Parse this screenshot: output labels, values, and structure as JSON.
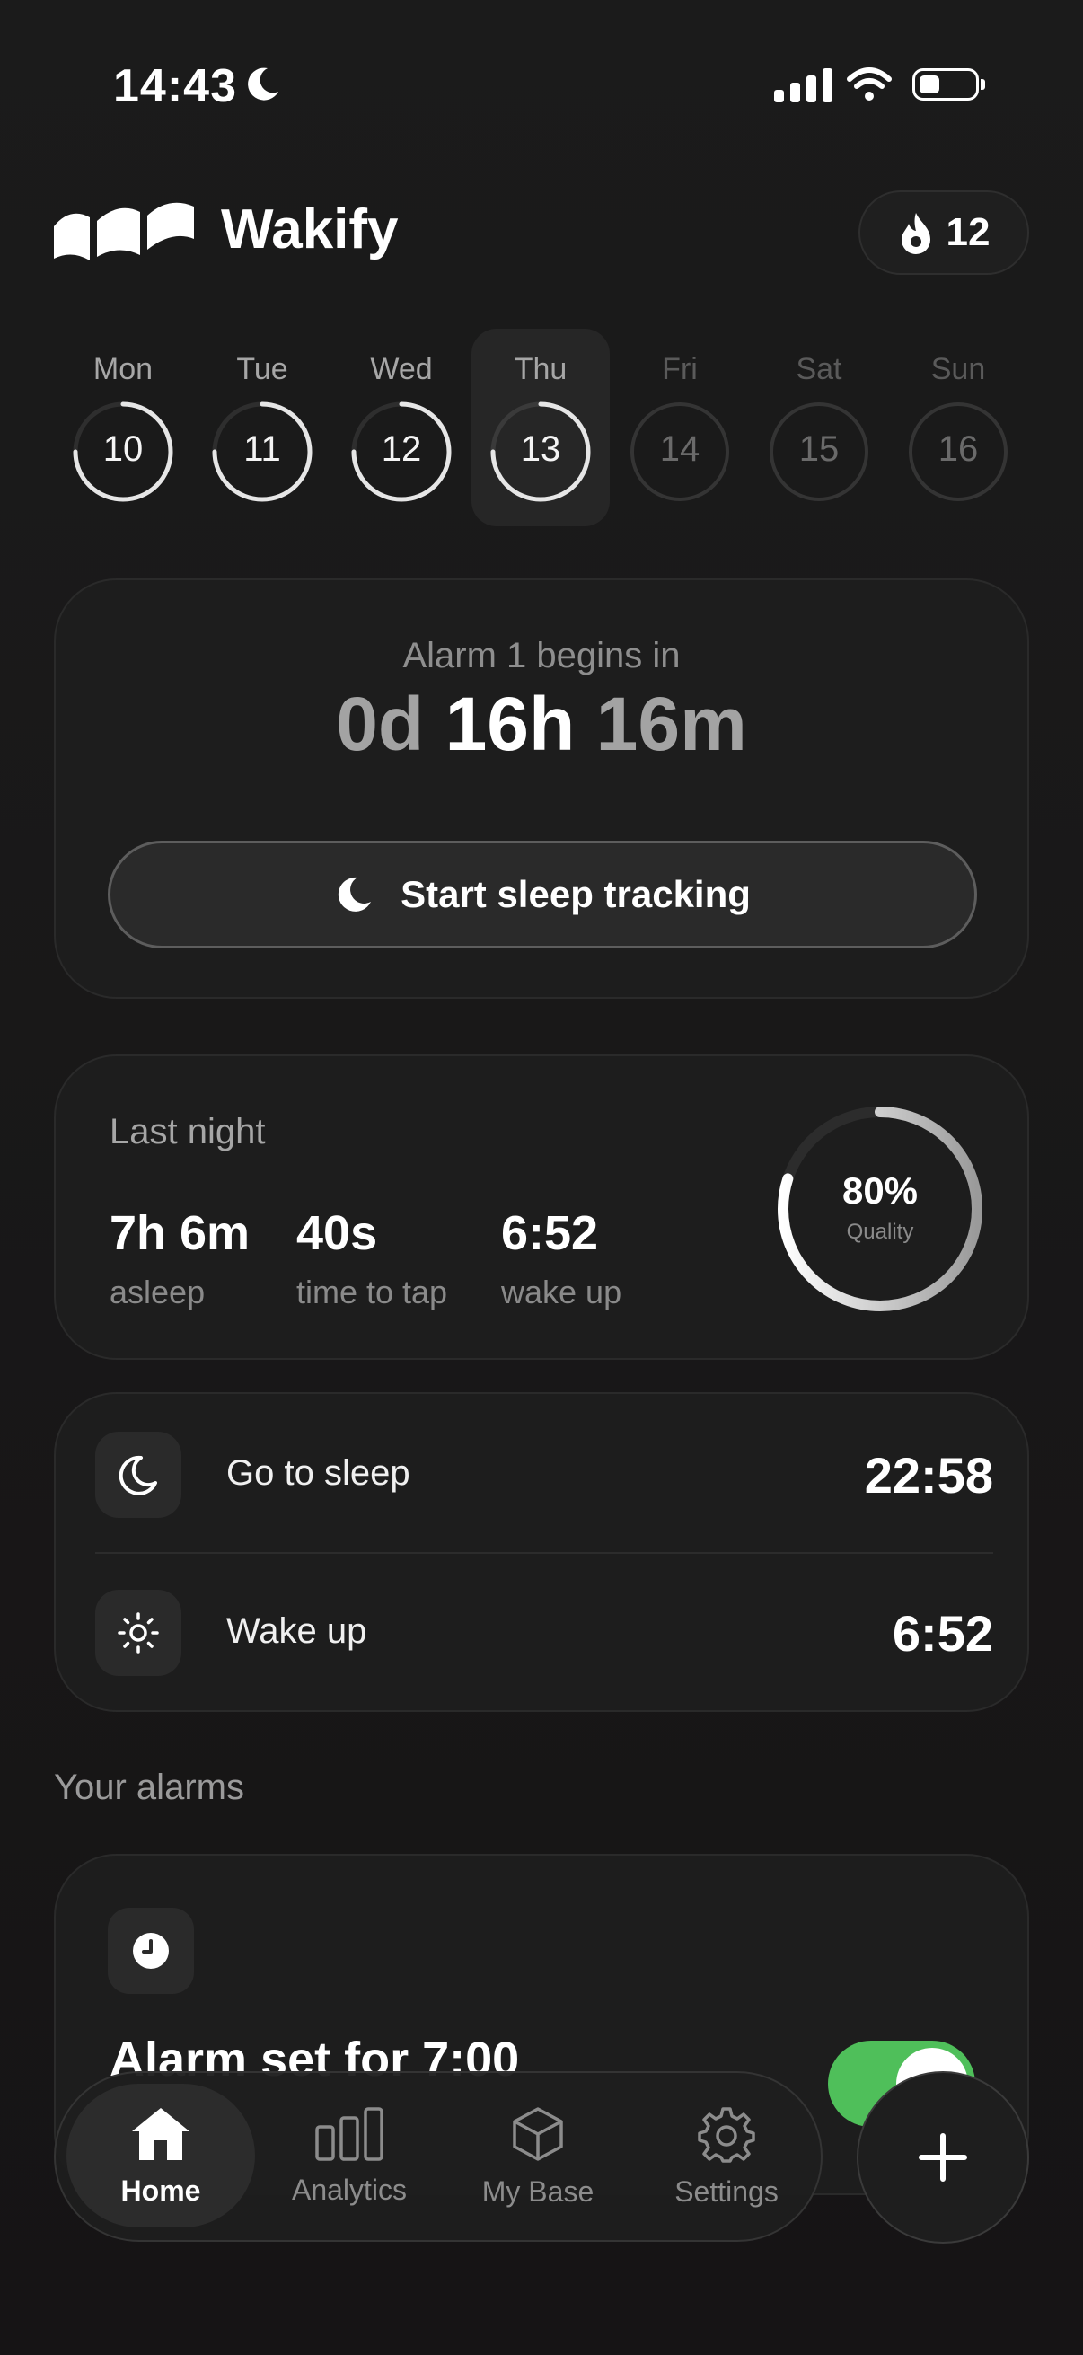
{
  "status_bar": {
    "time": "14:43",
    "moon_icon": "moon-icon",
    "signal_icon": "signal-icon",
    "wifi_icon": "wifi-icon",
    "battery_icon": "battery-icon"
  },
  "header": {
    "brand": "Wakify",
    "streak_count": "12",
    "streak_icon": "flame-icon"
  },
  "week": {
    "days": [
      {
        "name": "Mon",
        "num": "10",
        "state": "past",
        "progress": 0.75
      },
      {
        "name": "Tue",
        "num": "11",
        "state": "past",
        "progress": 0.75
      },
      {
        "name": "Wed",
        "num": "12",
        "state": "past",
        "progress": 0.75
      },
      {
        "name": "Thu",
        "num": "13",
        "state": "selected",
        "progress": 0.75
      },
      {
        "name": "Fri",
        "num": "14",
        "state": "future",
        "progress": 0
      },
      {
        "name": "Sat",
        "num": "15",
        "state": "future",
        "progress": 0
      },
      {
        "name": "Sun",
        "num": "16",
        "state": "future",
        "progress": 0
      }
    ]
  },
  "alarm_card": {
    "label": "Alarm 1 begins in",
    "countdown_days": "0d",
    "countdown_hours": "16h",
    "countdown_minutes": "16m",
    "button_label": "Start sleep tracking",
    "button_icon": "moon-icon"
  },
  "last_night": {
    "title": "Last night",
    "stats": [
      {
        "value": "7h 6m",
        "label": "asleep"
      },
      {
        "value": "40s",
        "label": "time to tap"
      },
      {
        "value": "6:52",
        "label": "wake up"
      }
    ],
    "quality_percent": "80%",
    "quality_value": 0.8,
    "quality_label": "Quality"
  },
  "schedule": {
    "sleep": {
      "label": "Go to sleep",
      "time": "22:58",
      "icon": "moon-icon"
    },
    "wake": {
      "label": "Wake up",
      "time": "6:52",
      "icon": "sun-icon"
    }
  },
  "alarms": {
    "section_title": "Your alarms",
    "items": [
      {
        "title": "Alarm set for 7:00",
        "enabled": true,
        "icon": "clock-icon"
      }
    ]
  },
  "nav": {
    "items": [
      {
        "label": "Home",
        "icon": "home-icon",
        "active": true
      },
      {
        "label": "Analytics",
        "icon": "analytics-icon",
        "active": false
      },
      {
        "label": "My Base",
        "icon": "cube-icon",
        "active": false
      },
      {
        "label": "Settings",
        "icon": "gear-icon",
        "active": false
      }
    ],
    "fab_icon": "plus-icon"
  },
  "colors": {
    "accent_green": "#4fbf5a",
    "background": "#1b1b1b",
    "card": "#1d1d1d"
  }
}
